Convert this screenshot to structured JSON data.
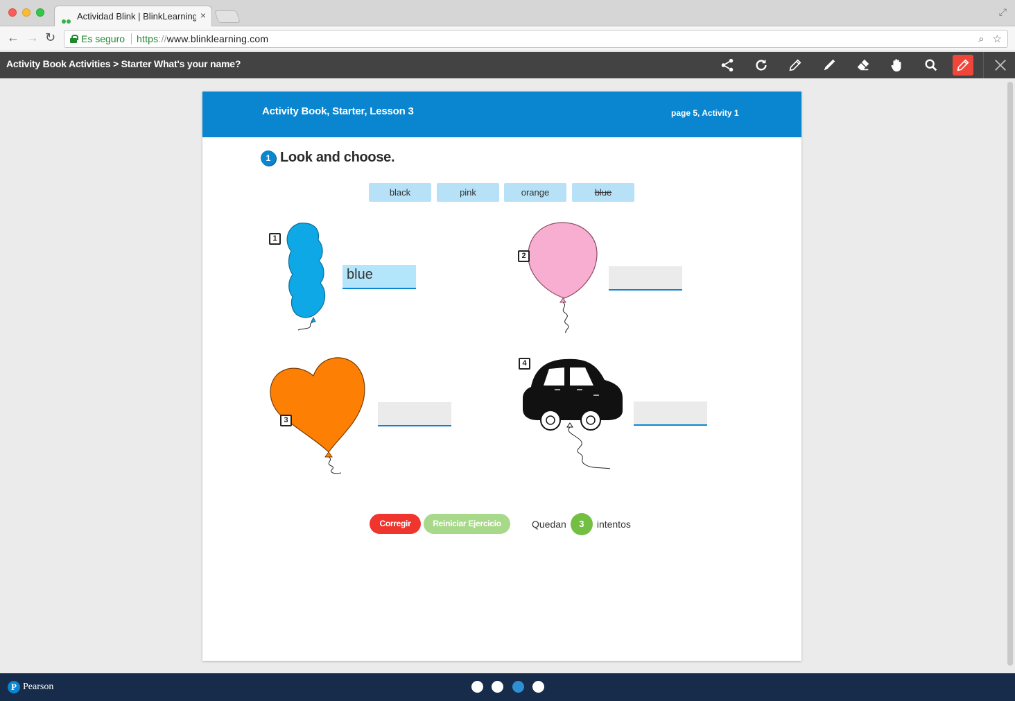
{
  "browser": {
    "tab_title": "Actividad Blink | BlinkLearning",
    "tab_close": "×",
    "secure_label": "Es seguro",
    "url_scheme": "https",
    "url_slashes": "://",
    "url_host": "www.blinklearning.com"
  },
  "app_header": {
    "breadcrumb": "Activity Book Activities > Starter What's your name?",
    "tools": [
      "share-icon",
      "refresh-icon",
      "pencil-icon",
      "marker-icon",
      "eraser-icon",
      "hand-icon",
      "search-icon",
      "edit-icon",
      "close-icon"
    ]
  },
  "page": {
    "banner_title": "Activity Book, Starter, Lesson 3",
    "banner_page": "page 5, Activity 1",
    "instruction_number": "1",
    "instruction": "Look and choose.",
    "word_bank": [
      {
        "label": "black",
        "used": false
      },
      {
        "label": "pink",
        "used": false
      },
      {
        "label": "orange",
        "used": false
      },
      {
        "label": "blue",
        "used": true
      }
    ],
    "items": [
      {
        "number": "1",
        "picture": "blue balloon",
        "answer": "blue"
      },
      {
        "number": "2",
        "picture": "pink balloon",
        "answer": ""
      },
      {
        "number": "3",
        "picture": "orange heart balloon",
        "answer": ""
      },
      {
        "number": "4",
        "picture": "black car balloon",
        "answer": ""
      }
    ],
    "check_button": "Corregir",
    "reset_button": "Reiniciar Ejercicio",
    "attempts_prefix": "Quedan",
    "attempts_count": "3",
    "attempts_suffix": "intentos"
  },
  "footer": {
    "logo_letter": "P",
    "brand": "Pearson",
    "pagination_active": 3,
    "pagination_total": 4
  },
  "colors": {
    "header_bg": "#434343",
    "banner_blue": "#0a85cf",
    "chip_blue": "#b7e1f7",
    "check_red": "#f0342e",
    "reset_green": "#a8d98a",
    "attempts_green": "#73bf43",
    "footer_navy": "#172c4b"
  }
}
